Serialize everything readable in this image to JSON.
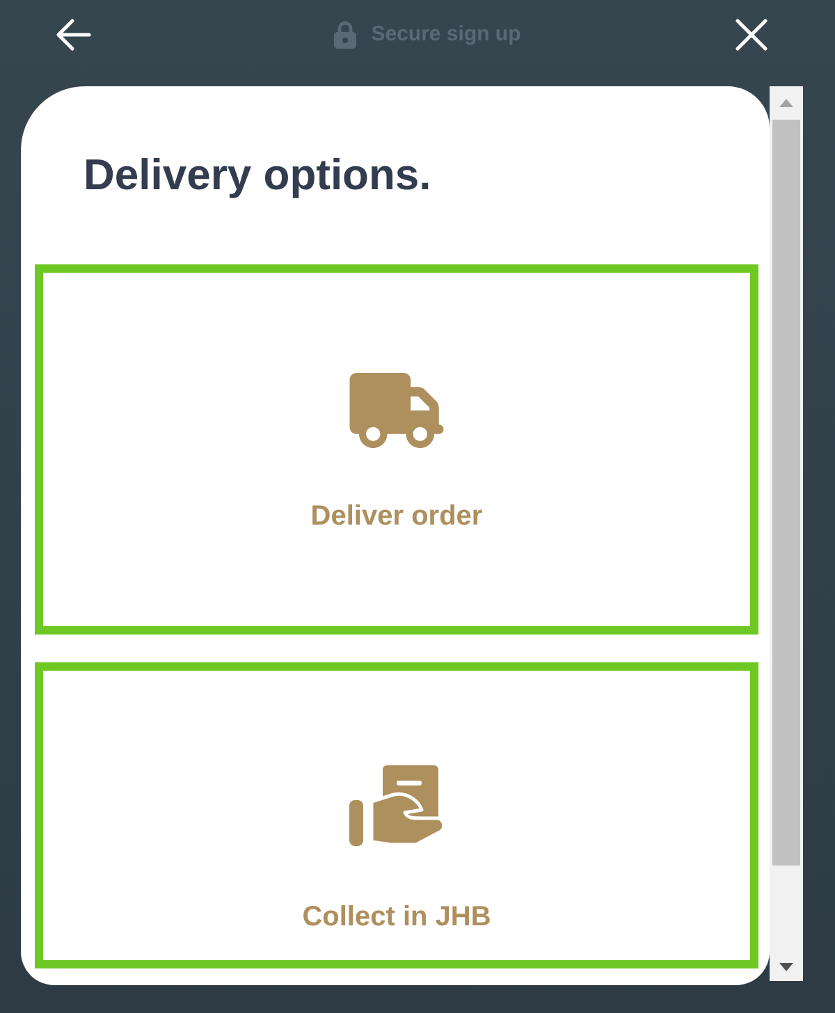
{
  "header": {
    "title": "Secure sign up"
  },
  "page": {
    "title": "Delivery options."
  },
  "options": [
    {
      "kind": "deliver",
      "label": "Deliver order",
      "outlined": true
    },
    {
      "kind": "collect",
      "label": "Collect in JHB",
      "outlined": true
    }
  ]
}
